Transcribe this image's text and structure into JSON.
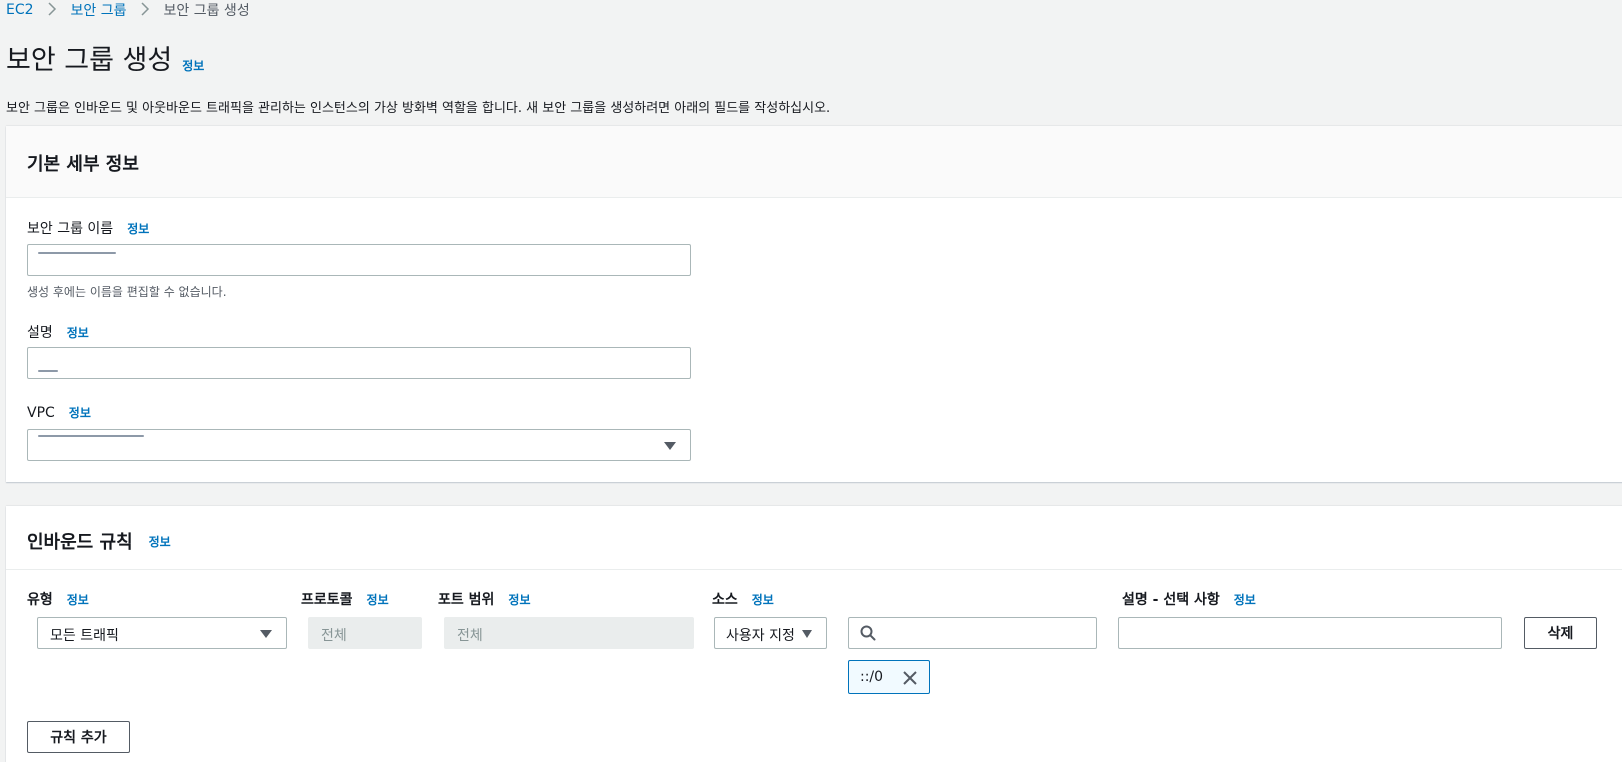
{
  "breadcrumb": {
    "items": [
      "EC2",
      "보안 그룹",
      "보안 그룹 생성"
    ]
  },
  "page": {
    "title": "보안 그룹 생성",
    "info_link": "정보",
    "description": "보안 그룹은 인바운드 및 아웃바운드 트래픽을 관리하는 인스턴스의 가상 방화벽 역할을 합니다. 새 보안 그룹을 생성하려면 아래의 필드를 작성하십시오."
  },
  "basic": {
    "heading": "기본 세부 정보",
    "name_label": "보안 그룹 이름",
    "name_info": "정보",
    "name_hint": "생성 후에는 이름을 편집할 수 없습니다.",
    "desc_label": "설명",
    "desc_info": "정보",
    "vpc_label": "VPC",
    "vpc_info": "정보"
  },
  "inbound": {
    "heading": "인바운드 규칙",
    "heading_info": "정보",
    "columns": {
      "type": "유형",
      "type_info": "정보",
      "protocol": "프로토콜",
      "protocol_info": "정보",
      "port": "포트 범위",
      "port_info": "정보",
      "source": "소스",
      "source_info": "정보",
      "description": "설명 - 선택 사항",
      "description_info": "정보"
    },
    "rule": {
      "type": "모든 트래픽",
      "protocol": "전체",
      "port": "전체",
      "source_mode": "사용자 지정",
      "source_token": "::/0",
      "delete_label": "삭제"
    },
    "add_rule_label": "규칙 추가"
  },
  "icons": {
    "crumb_sep": "chevron-right-icon",
    "search": "search-icon",
    "remove": "close-icon",
    "dropdown": "caret-down-icon"
  }
}
